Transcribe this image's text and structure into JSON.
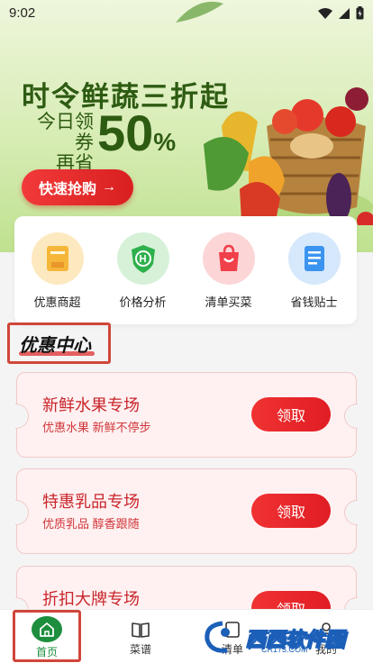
{
  "status": {
    "time": "9:02"
  },
  "hero": {
    "title": "时令鲜蔬三折起",
    "sub_line1": "今日领券",
    "sub_line2": "再省",
    "percent": "50",
    "percent_sign": "%",
    "cta_label": "快速抢购",
    "cta_arrow": "→"
  },
  "quick_nav": [
    {
      "label": "优惠商超",
      "icon": "tag-icon",
      "color": "#f5b63a",
      "bg": "#fde9bf"
    },
    {
      "label": "价格分析",
      "icon": "shield-price-icon",
      "color": "#2eb04c",
      "bg": "#d6f1d8"
    },
    {
      "label": "清单买菜",
      "icon": "shopping-bag-icon",
      "color": "#f0404a",
      "bg": "#fcd6d7"
    },
    {
      "label": "省钱贴士",
      "icon": "clipboard-icon",
      "color": "#3b94f0",
      "bg": "#d6e8fb"
    }
  ],
  "section": {
    "title": "优惠中心"
  },
  "coupons": [
    {
      "title": "新鲜水果专场",
      "desc": "优惠水果  新鲜不停步",
      "button": "领取"
    },
    {
      "title": "特惠乳品专场",
      "desc": "优质乳品  醇香跟随",
      "button": "领取"
    },
    {
      "title": "折扣大牌专场",
      "desc": "",
      "button": "领取"
    }
  ],
  "tabbar": {
    "home": "首页",
    "recipes": "菜谱",
    "list": "清单",
    "mine": "我的"
  },
  "watermark": {
    "brand": "西西软件园",
    "url": "CR173.COM"
  },
  "colors": {
    "accent_red": "#e52a2f",
    "brand_green": "#1c8e3e",
    "hero_green": "#2e5b12"
  }
}
